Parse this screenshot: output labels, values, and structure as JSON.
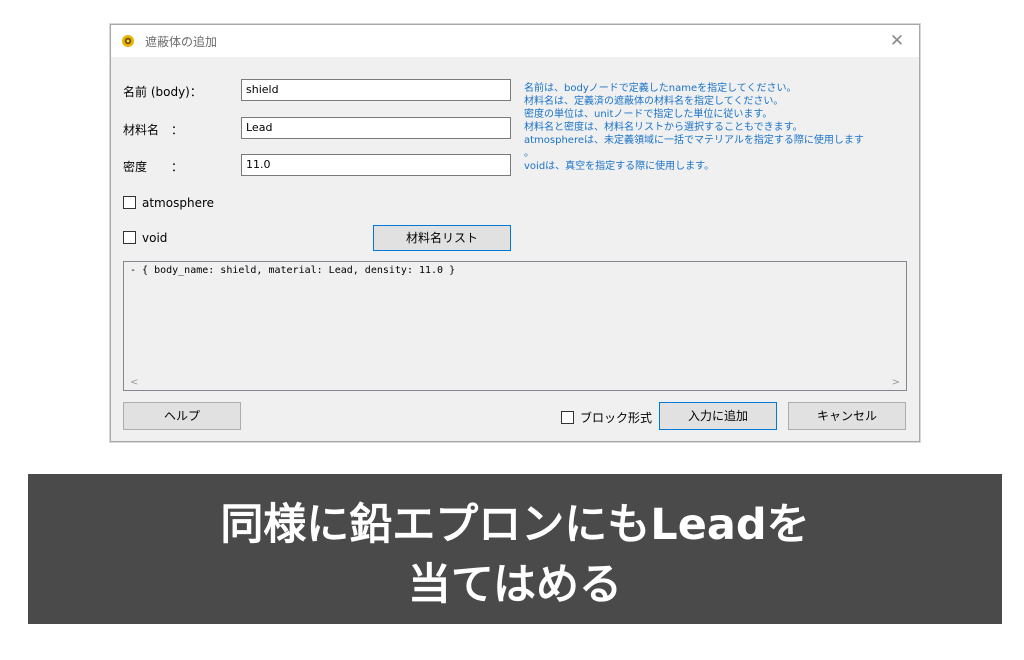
{
  "window": {
    "title": "遮蔽体の追加",
    "close_glyph": "✕"
  },
  "form": {
    "name_label": "名前 (body)：",
    "name_value": "shield",
    "material_label": "材料名　：",
    "material_value": "Lead",
    "density_label": "密度　　：",
    "density_value": "11.0",
    "atmosphere_label": "atmosphere",
    "void_label": "void",
    "material_list_button": "材料名リスト"
  },
  "help_lines": [
    "名前は、bodyノードで定義したnameを指定してください。",
    "材料名は、定義済の遮蔽体の材料名を指定してください。",
    "密度の単位は、unitノードで指定した単位に従います。",
    "材料名と密度は、材料名リストから選択することもできます。",
    "atmosphereは、未定義領域に一括でマテリアルを指定する際に使用します",
    "。",
    "voidは、真空を指定する際に使用します。"
  ],
  "yaml_preview": "- { body_name: shield, material: Lead, density: 11.0 }",
  "scroll": {
    "left": "<",
    "right": ">"
  },
  "footer": {
    "help_button": "ヘルプ",
    "block_format_label": "ブロック形式",
    "add_button": "入力に追加",
    "cancel_button": "キャンセル"
  },
  "banner": {
    "line1": "同様に鉛エプロンにもLeadを",
    "line2": "当てはめる"
  },
  "colors": {
    "help_text": "#1a73c8",
    "banner_bg": "#4a4a4a",
    "primary_border": "#0078d7"
  }
}
